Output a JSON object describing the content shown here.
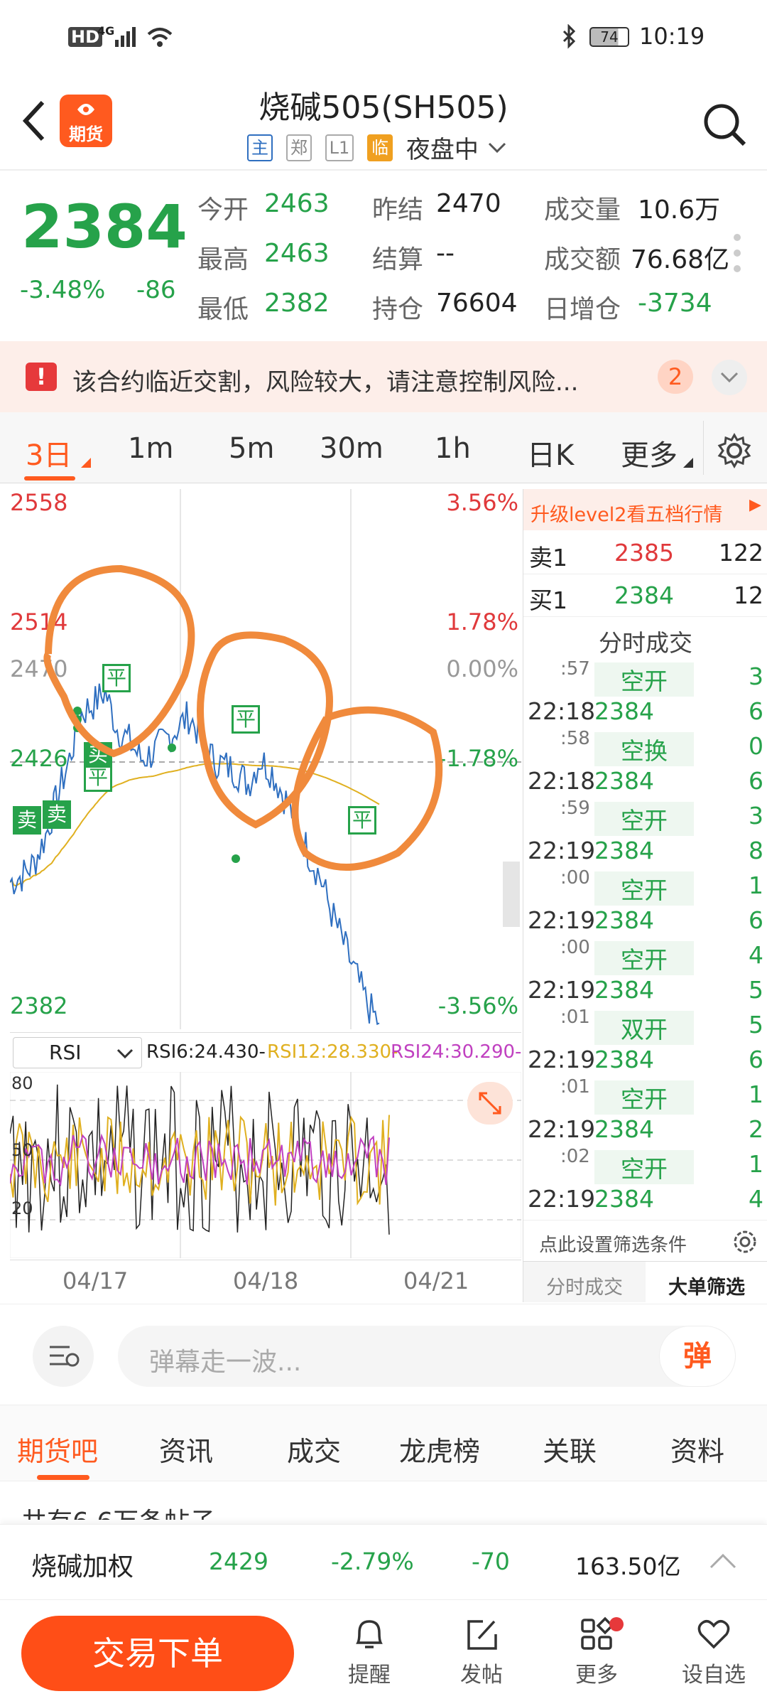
{
  "status": {
    "time": "10:19",
    "battery": "74",
    "hd": "HD",
    "net": "4G"
  },
  "header": {
    "title": "烧碱505(SH505)",
    "logo": "期货",
    "tags": [
      "主",
      "郑",
      "L1",
      "临"
    ],
    "session": "夜盘中"
  },
  "quote": {
    "price": "2384",
    "pct": "-3.48%",
    "chg": "-86",
    "rows": [
      [
        {
          "l": "今开",
          "v": "2463"
        },
        {
          "l": "昨结",
          "v": "2470"
        },
        {
          "l": "成交量",
          "v": "10.6万"
        }
      ],
      [
        {
          "l": "最高",
          "v": "2463"
        },
        {
          "l": "结算",
          "v": "--"
        },
        {
          "l": "成交额",
          "v": "76.68亿"
        }
      ],
      [
        {
          "l": "最低",
          "v": "2382"
        },
        {
          "l": "持仓",
          "v": "76604"
        },
        {
          "l": "日增仓",
          "v": "-3734"
        }
      ]
    ]
  },
  "warning": {
    "text": "该合约临近交割，风险较大，请注意控制风险...",
    "count": "2"
  },
  "tabs": [
    "3日",
    "1m",
    "5m",
    "30m",
    "1h",
    "日K",
    "更多"
  ],
  "chart": {
    "ylabels": [
      "2558",
      "2514",
      "2470",
      "2426",
      "2382"
    ],
    "pctlabels": [
      "3.56%",
      "1.78%",
      "0.00%",
      "-1.78%",
      "-3.56%"
    ],
    "markers": [
      "卖",
      "卖",
      "平",
      "平",
      "买",
      "平",
      "平"
    ],
    "rsi_select": "RSI",
    "rsi6": "RSI6:24.430-",
    "rsi12": "RSI12:28.330-",
    "rsi24": "RSI24:30.290-",
    "rsi_ticks": [
      "80",
      "50",
      "20"
    ],
    "dates": [
      "04/17",
      "04/18",
      "04/21"
    ],
    "line_color": "#2f6fc0",
    "avg_color": "#e0b020"
  },
  "chart_data": {
    "type": "line",
    "x": [
      "04/17",
      "04/18",
      "04/21"
    ],
    "ylim": [
      2382,
      2558
    ],
    "series": [
      {
        "values": [
          2430,
          2432,
          2436,
          2445,
          2458,
          2470,
          2485,
          2488,
          2492,
          2480,
          2476,
          2470,
          2472,
          2476,
          2480,
          2484,
          2478,
          2470,
          2468,
          2466,
          2462,
          2470,
          2466,
          2458,
          2450,
          2440,
          2432,
          2420,
          2410,
          2400,
          2390,
          2384
        ]
      }
    ]
  },
  "side": {
    "upgrade": "升级level2看五档行情",
    "ask": {
      "label": "卖1",
      "price": "2385",
      "vol": "122"
    },
    "bid": {
      "label": "买1",
      "price": "2384",
      "vol": "12"
    },
    "title": "分时成交",
    "trades": [
      [
        ":57",
        "空开",
        "3"
      ],
      [
        "22:18",
        "2384",
        "6"
      ],
      [
        ":58",
        "空换",
        "0"
      ],
      [
        "22:18",
        "2384",
        "6"
      ],
      [
        ":59",
        "空开",
        "3"
      ],
      [
        "22:19",
        "2384",
        "8"
      ],
      [
        ":00",
        "空开",
        "1"
      ],
      [
        "22:19",
        "2384",
        "6"
      ],
      [
        ":00",
        "空开",
        "4"
      ],
      [
        "22:19",
        "2384",
        "5"
      ],
      [
        ":01",
        "双开",
        "5"
      ],
      [
        "22:19",
        "2384",
        "6"
      ],
      [
        ":01",
        "空开",
        "1"
      ],
      [
        "22:19",
        "2384",
        "2"
      ],
      [
        ":02",
        "空开",
        "1"
      ],
      [
        "22:19",
        "2384",
        "4"
      ]
    ],
    "filter": "点此设置筛选条件",
    "tab1": "分时成交",
    "tab2": "大单筛选"
  },
  "danmu": {
    "placeholder": "弹幕走一波...",
    "btn": "弹"
  },
  "bottom_tabs": [
    "期货吧",
    "资讯",
    "成交",
    "龙虎榜",
    "关联",
    "资料"
  ],
  "posts": "共有6.6万条帖子",
  "index": {
    "name": "烧碱加权",
    "price": "2429",
    "pct": "-2.79%",
    "chg": "-70",
    "amount": "163.50亿"
  },
  "footer": {
    "trade": "交易下单",
    "items": [
      "提醒",
      "发帖",
      "更多",
      "设自选"
    ]
  }
}
